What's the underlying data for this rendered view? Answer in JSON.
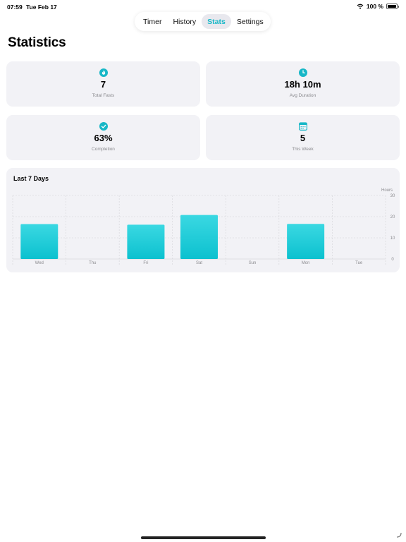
{
  "status_bar": {
    "time": "07:59",
    "date": "Tue Feb 17",
    "battery": "100 %"
  },
  "tabs": [
    {
      "label": "Timer",
      "active": false
    },
    {
      "label": "History",
      "active": false
    },
    {
      "label": "Stats",
      "active": true
    },
    {
      "label": "Settings",
      "active": false
    }
  ],
  "title": "Statistics",
  "accent_color": "#17b7c7",
  "stats": {
    "total_fasts": {
      "value": "7",
      "label": "Total Fasts",
      "icon": "flame-icon"
    },
    "avg_duration": {
      "value": "18h 10m",
      "label": "Avg Duration",
      "icon": "clock-icon"
    },
    "completion": {
      "value": "63%",
      "label": "Completion",
      "icon": "checkmark-circle-icon"
    },
    "this_week": {
      "value": "5",
      "label": "This Week",
      "icon": "calendar-icon"
    }
  },
  "chart": {
    "title": "Last 7 Days",
    "unit_label": "Hours"
  },
  "chart_data": {
    "type": "bar",
    "title": "Last 7 Days",
    "ylabel": "Hours",
    "categories": [
      "Wed",
      "Thu",
      "Fri",
      "Sat",
      "Sun",
      "Mon",
      "Tue"
    ],
    "values": [
      16.5,
      0,
      16.2,
      20.8,
      0,
      16.6,
      0
    ],
    "ylim": [
      0,
      30
    ],
    "yticks": [
      0,
      10,
      20,
      30
    ],
    "grid": true
  }
}
